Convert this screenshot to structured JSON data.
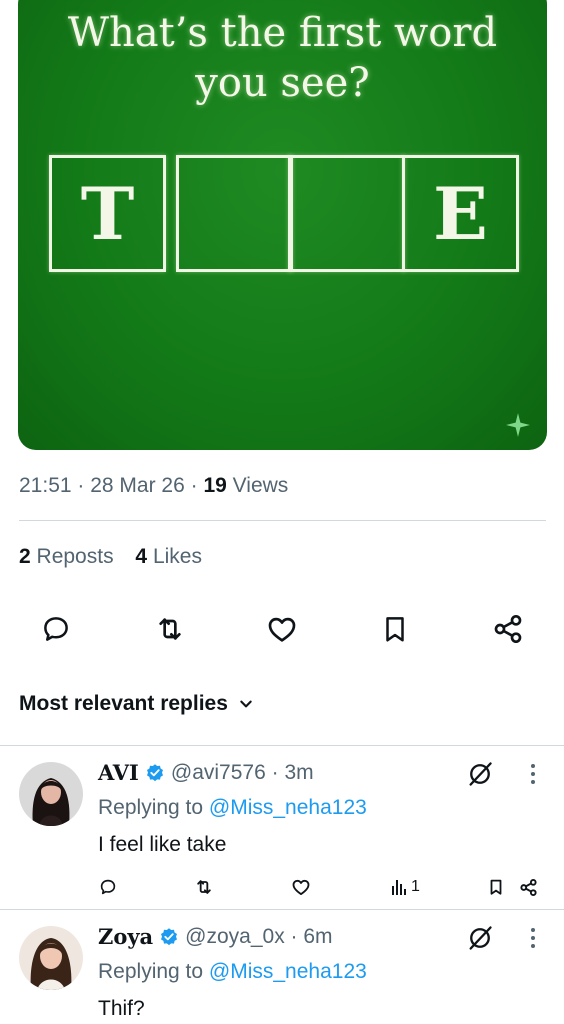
{
  "post": {
    "image_title_line1": "What’s the first word",
    "image_title_line2": "you see?",
    "letters": [
      "T",
      "",
      "",
      "E"
    ],
    "time": "21:51",
    "date": "28 Mar 26",
    "views_count": "19",
    "views_label": "Views",
    "reposts_count": "2",
    "reposts_label": "Reposts",
    "likes_count": "4",
    "likes_label": "Likes"
  },
  "replies_header": {
    "sort_label": "Most relevant replies"
  },
  "replies": [
    {
      "name": "AVI",
      "handle": "@avi7576",
      "time": "3m",
      "replying_prefix": "Replying to",
      "replying_to": "@Miss_neha123",
      "text": "I feel like take",
      "views": "1"
    },
    {
      "name": "Zoya",
      "handle": "@zoya_0x",
      "time": "6m",
      "replying_prefix": "Replying to",
      "replying_to": "@Miss_neha123",
      "text": "Thif?"
    }
  ],
  "colors": {
    "accent": "#1d9bf0",
    "puzzle_green": "#137a18",
    "muted": "#536471"
  },
  "icons": [
    "reply-icon",
    "repost-icon",
    "like-icon",
    "bookmark-icon",
    "share-icon",
    "grok-icon",
    "more-icon",
    "verified-icon",
    "chevron-down-icon",
    "sparkle-icon",
    "views-icon"
  ]
}
